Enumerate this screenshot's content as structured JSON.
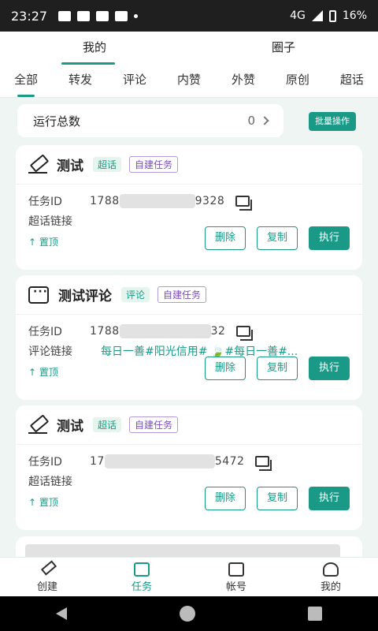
{
  "status_bar": {
    "time": "23:27",
    "battery": "16%",
    "network": "4G"
  },
  "top_tabs": [
    {
      "label": "我的",
      "active": true
    },
    {
      "label": "圈子",
      "active": false
    }
  ],
  "sub_tabs": [
    {
      "label": "全部",
      "active": true
    },
    {
      "label": "转发"
    },
    {
      "label": "评论"
    },
    {
      "label": "内赞"
    },
    {
      "label": "外赞"
    },
    {
      "label": "原创"
    },
    {
      "label": "超话"
    }
  ],
  "summary": {
    "label": "运行总数",
    "count": "0",
    "batch_button": "批量操作"
  },
  "cards": [
    {
      "icon": "edit-icon",
      "title": "测试",
      "tag1": "超话",
      "tag2": "自建任务",
      "id_label": "任务ID",
      "id_prefix": "1788",
      "id_suffix": "9328",
      "link_label": "超话链接",
      "link_value": "",
      "pin": "↑ 置顶",
      "btn_delete": "删除",
      "btn_copy": "复制",
      "btn_run": "执行"
    },
    {
      "icon": "message-icon",
      "title": "测试评论",
      "tag1": "评论",
      "tag2": "自建任务",
      "id_label": "任务ID",
      "id_prefix": "1788",
      "id_suffix": "32",
      "link_label": "评论链接",
      "link_value": "每日一善#阳光信用# 🍃#每日一善#...",
      "pin": "↑ 置顶",
      "btn_delete": "删除",
      "btn_copy": "复制",
      "btn_run": "执行"
    },
    {
      "icon": "edit-icon",
      "title": "测试",
      "tag1": "超话",
      "tag2": "自建任务",
      "id_label": "任务ID",
      "id_prefix": "17",
      "id_suffix": "5472",
      "link_label": "超话链接",
      "link_value": "",
      "pin": "↑ 置顶",
      "btn_delete": "删除",
      "btn_copy": "复制",
      "btn_run": "执行"
    }
  ],
  "bottom_nav": [
    {
      "label": "创建",
      "icon": "pen-icon",
      "active": false
    },
    {
      "label": "任务",
      "icon": "task-icon",
      "active": true
    },
    {
      "label": "帐号",
      "icon": "account-icon",
      "active": false
    },
    {
      "label": "我的",
      "icon": "user-icon",
      "active": false
    }
  ],
  "colors": {
    "accent": "#1a9a86",
    "tag_purple": "#7a4fb8",
    "background": "#eef5f2"
  }
}
